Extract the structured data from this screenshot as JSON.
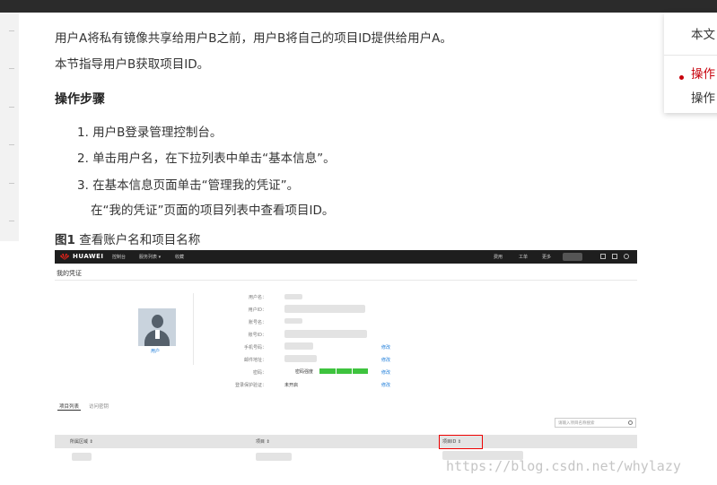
{
  "content": {
    "intro_line1": "用户A将私有镜像共享给用户B之前，用户B将自己的项目ID提供给用户A。",
    "intro_line2": "本节指导用户B获取项目ID。",
    "steps_heading": "操作步骤",
    "steps": [
      "1. 用户B登录管理控制台。",
      "2. 单击用户名，在下拉列表中单击“基本信息”。",
      "3. 在基本信息页面单击“管理我的凭证”。"
    ],
    "step3_sub": "在“我的凭证”页面的项目列表中查看项目ID。",
    "figure_number": "图1",
    "figure_title": "查看账户名和项目名称"
  },
  "toc": {
    "item1": "本文",
    "item2": "操作",
    "item3": "操作"
  },
  "screenshot": {
    "brand": "HUAWEI",
    "nav_menu": [
      "控制台",
      "服务列表 ▾",
      "收藏"
    ],
    "nav_right": [
      "费用",
      "工单",
      "更多"
    ],
    "page_title": "我的凭证",
    "user_link": "用户",
    "fields": [
      "用户名：",
      "用户ID：",
      "账号名：",
      "账号ID：",
      "手机号码：",
      "邮件地址：",
      "密码：",
      "登录保护验证："
    ],
    "strength_label": "密码强度",
    "protect_value": "未开启",
    "edit_label": "修改",
    "tabs": [
      "项目列表",
      "访问密钥"
    ],
    "search_placeholder": "请输入项目名称搜索",
    "table_headers": [
      "所属区域 ⇕",
      "项目 ⇕",
      "项目ID ⇕"
    ]
  },
  "watermark": "https://blog.csdn.net/whylazy",
  "colors": {
    "accent_red": "#c7000b",
    "link_blue": "#1a7bd9"
  }
}
